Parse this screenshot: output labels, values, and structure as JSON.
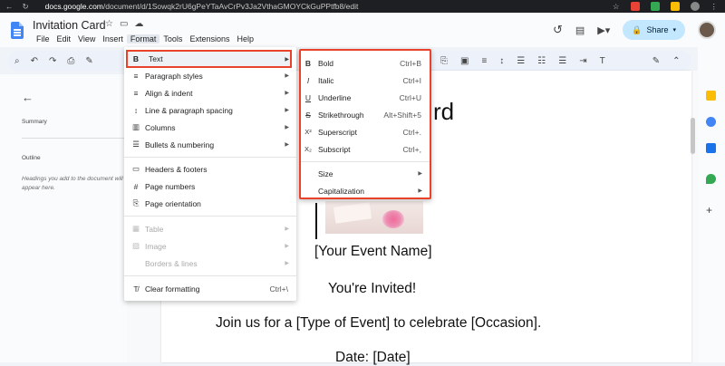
{
  "browser": {
    "url_host": "docs.google.com",
    "url_rest": "/document/d/1Sowqk2rU6gPeYTaAvCrPv3Ja2VthaGMOYCkGuPPtfb8/edit",
    "nav_icons": [
      "back-icon",
      "reload-icon"
    ]
  },
  "doc": {
    "title": "Invitation Card",
    "menus": [
      "File",
      "Edit",
      "View",
      "Insert",
      "Format",
      "Tools",
      "Extensions",
      "Help"
    ],
    "active_menu": "Format",
    "share_label": "Share"
  },
  "sidebar": {
    "summary_label": "Summary",
    "outline_label": "Outline",
    "outline_hint": "Headings you add to the document will appear here."
  },
  "document": {
    "heading_fragment": "rd",
    "event_name": "[Your Event Name]",
    "invited": "You're Invited!",
    "join_line": "Join us for a [Type of Event] to celebrate [Occasion].",
    "date_line": "Date: [Date]"
  },
  "format_menu": {
    "items": [
      {
        "label": "Text",
        "icon": "B",
        "submenu": true,
        "highlighted": true
      },
      {
        "label": "Paragraph styles",
        "icon": "≡",
        "submenu": true
      },
      {
        "label": "Align & indent",
        "icon": "≡",
        "submenu": true
      },
      {
        "label": "Line & paragraph spacing",
        "icon": "↕",
        "submenu": true
      },
      {
        "label": "Columns",
        "icon": "▥",
        "submenu": true
      },
      {
        "label": "Bullets & numbering",
        "icon": "☰",
        "submenu": true
      },
      {
        "label": "Headers & footers",
        "icon": "▭"
      },
      {
        "label": "Page numbers",
        "icon": "#"
      },
      {
        "label": "Page orientation",
        "icon": "⎘"
      },
      {
        "label": "Table",
        "icon": "▦",
        "submenu": true,
        "disabled": true
      },
      {
        "label": "Image",
        "icon": "▨",
        "submenu": true,
        "disabled": true
      },
      {
        "label": "Borders & lines",
        "icon": "",
        "submenu": true,
        "disabled": true
      },
      {
        "label": "Clear formatting",
        "icon": "T̸",
        "shortcut": "Ctrl+\\"
      }
    ]
  },
  "text_submenu": {
    "items": [
      {
        "label": "Bold",
        "icon": "B",
        "shortcut": "Ctrl+B"
      },
      {
        "label": "Italic",
        "icon": "I",
        "shortcut": "Ctrl+I"
      },
      {
        "label": "Underline",
        "icon": "U",
        "shortcut": "Ctrl+U"
      },
      {
        "label": "Strikethrough",
        "icon": "S",
        "shortcut": "Alt+Shift+5"
      },
      {
        "label": "Superscript",
        "icon": "X²",
        "shortcut": "Ctrl+."
      },
      {
        "label": "Subscript",
        "icon": "X₂",
        "shortcut": "Ctrl+,"
      },
      {
        "label": "Size",
        "submenu": true
      },
      {
        "label": "Capitalization",
        "submenu": true
      }
    ]
  },
  "colors": {
    "highlight_border": "#e8432a",
    "share_bg": "#c2e7ff",
    "docs_blue": "#4285f4"
  }
}
